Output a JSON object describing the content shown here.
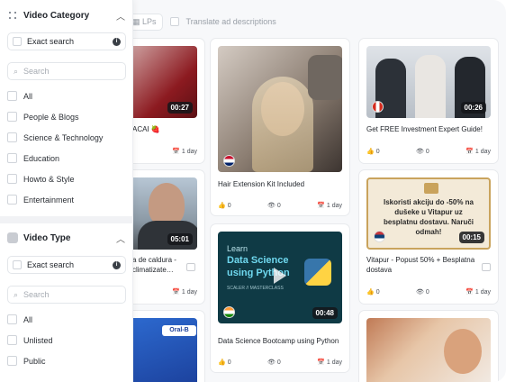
{
  "topbar": {
    "lps_label": "LPs",
    "translate_label": "Translate ad descriptions"
  },
  "filters": {
    "video_category": {
      "title": "Video Category",
      "exact_search": "Exact search",
      "search_placeholder": "Search",
      "options": [
        "All",
        "People & Blogs",
        "Science & Technology",
        "Education",
        "Howto & Style",
        "Entertainment"
      ]
    },
    "video_type": {
      "title": "Video Type",
      "exact_search": "Exact search",
      "search_placeholder": "Search",
      "options": [
        "All",
        "Unlisted",
        "Public"
      ]
    }
  },
  "cards": [
    {
      "id": "c1",
      "duration": "00:27",
      "title": "ACAI 🍓",
      "days": "1 day"
    },
    {
      "id": "c2",
      "duration": "05:01",
      "title_line1": "a de caldura -",
      "title_line2": "climatizate…",
      "days": "1 day"
    },
    {
      "id": "c3",
      "title": "",
      "days": ""
    },
    {
      "id": "c4",
      "title": "Hair Extension Kit Included",
      "likes": "0",
      "views": "0",
      "days": "1 day"
    },
    {
      "id": "c5",
      "duration": "00:48",
      "thumb_text": [
        "Learn",
        "Data Science",
        "using Python"
      ],
      "thumb_small": "SCALER // MASTERCLASS",
      "title": "Data Science Bootcamp using Python",
      "likes": "0",
      "views": "0",
      "days": "1 day"
    },
    {
      "id": "c6",
      "duration": "00:26",
      "title": "Get FREE Investment Expert Guide!",
      "likes": "0",
      "views": "0",
      "days": "1 day"
    },
    {
      "id": "c7",
      "duration": "00:15",
      "thumb_text": "Iskoristi akciju do -50% na dušeke u Vitapur uz besplatnu dostavu. Naruči odmah!",
      "title_line1": "Vitapur - Popust 50% + Besplatna",
      "title_line2": "dostava",
      "likes": "0",
      "views": "0",
      "days": "1 day"
    },
    {
      "id": "c8",
      "title": "",
      "days": ""
    }
  ],
  "colors": {
    "accent": "#1f2329",
    "duration_bg": "#14161a",
    "sidebar_bg": "#ffffff",
    "content_bg": "#f7f8fa"
  }
}
